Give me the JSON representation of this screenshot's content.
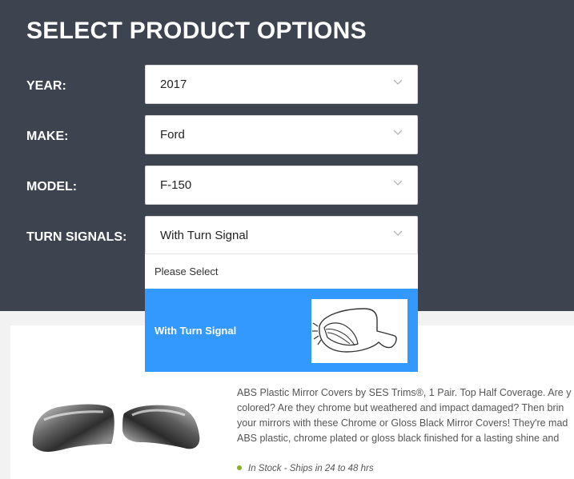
{
  "panel": {
    "title": "SELECT PRODUCT OPTIONS"
  },
  "fields": {
    "year": {
      "label": "YEAR:",
      "value": "2017"
    },
    "make": {
      "label": "MAKE:",
      "value": "Ford"
    },
    "model": {
      "label": "MODEL:",
      "value": "F-150"
    },
    "turn_signals": {
      "label": "TURN SIGNALS:",
      "value": "With Turn Signal"
    }
  },
  "dropdown": {
    "options": [
      {
        "label": "Please Select",
        "selected": false
      },
      {
        "label": "With Turn Signal",
        "selected": true,
        "image": "mirror-with-turn-signal-illustration"
      }
    ]
  },
  "product": {
    "image": "chrome-mirror-covers-photo",
    "description_lines": [
      "ABS Plastic Mirror Covers by SES Trims®, 1 Pair. Top Half Coverage. Are y",
      "colored? Are they chrome but weathered and impact damaged? Then brin",
      "your mirrors with these Chrome or Gloss Black Mirror Covers! They're mad",
      "ABS plastic, chrome plated or gloss black finished for a lasting shine and"
    ],
    "stock_text": "In Stock - Ships in 24 to 48 hrs"
  },
  "colors": {
    "panel_bg": "#3d444f",
    "selected_option_bg": "#3399ff",
    "stock_dot": "#8ab12a"
  },
  "icons": {
    "select_arrow": "chevron-down-icon",
    "stock_indicator": "dot-icon"
  }
}
